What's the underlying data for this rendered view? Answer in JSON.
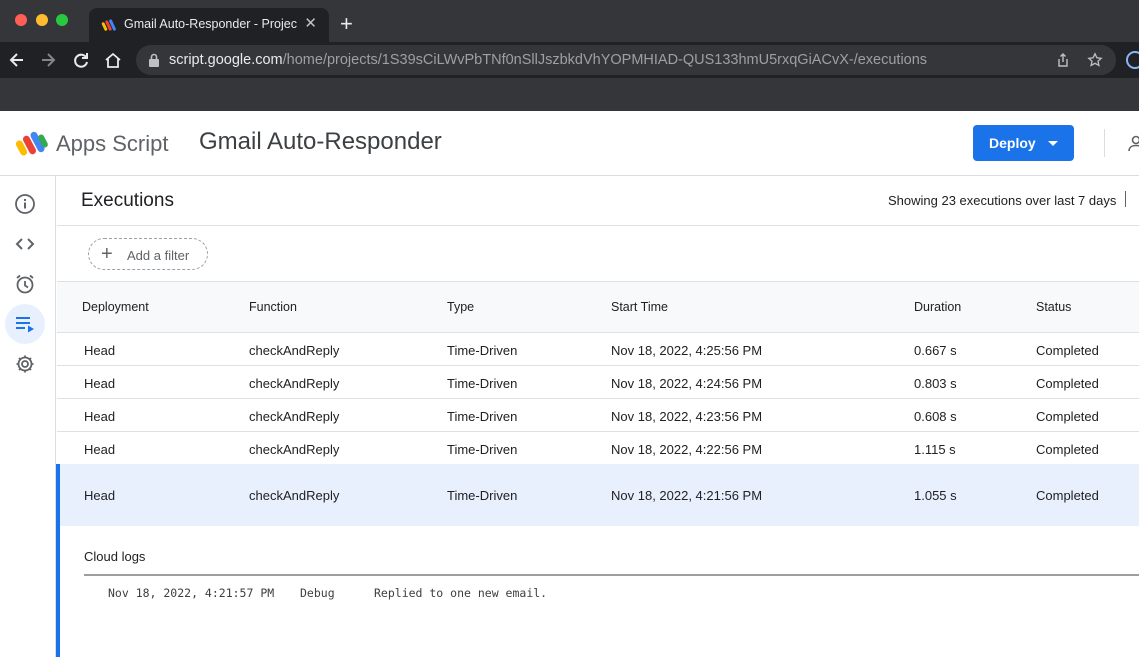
{
  "browser": {
    "tab_title": "Gmail Auto-Responder - Projec",
    "tab_close": "✕",
    "new_tab": "+",
    "url_host": "script.google.com",
    "url_path": "/home/projects/1S39sCiLWvPbTNf0nSllJszbkdVhYOPMHIAD-QUS133hmU5rxqGiACvX-/executions",
    "icons": [
      "back-icon",
      "forward-icon",
      "reload-icon",
      "home-icon",
      "lock-icon",
      "share-icon",
      "star-icon",
      "profile-icon"
    ]
  },
  "header": {
    "product_name": "Apps Script",
    "project_name": "Gmail Auto-Responder",
    "deploy_label": "Deploy"
  },
  "rail": {
    "items": [
      "overview-icon",
      "editor-icon",
      "triggers-icon",
      "executions-icon",
      "settings-icon"
    ],
    "active": "executions-icon"
  },
  "main": {
    "title": "Executions",
    "showing_text": "Showing 23 executions over last 7 days",
    "filter_label": "Add a filter",
    "filter_icon": "+",
    "columns": [
      "Deployment",
      "Function",
      "Type",
      "Start Time",
      "Duration",
      "Status"
    ],
    "rows": [
      [
        "Head",
        "checkAndReply",
        "Time-Driven",
        "Nov 18, 2022, 4:25:56 PM",
        "0.667 s",
        "Completed"
      ],
      [
        "Head",
        "checkAndReply",
        "Time-Driven",
        "Nov 18, 2022, 4:24:56 PM",
        "0.803 s",
        "Completed"
      ],
      [
        "Head",
        "checkAndReply",
        "Time-Driven",
        "Nov 18, 2022, 4:23:56 PM",
        "0.608 s",
        "Completed"
      ],
      [
        "Head",
        "checkAndReply",
        "Time-Driven",
        "Nov 18, 2022, 4:22:56 PM",
        "1.115 s",
        "Completed"
      ],
      [
        "Head",
        "checkAndReply",
        "Time-Driven",
        "Nov 18, 2022, 4:21:56 PM",
        "1.055 s",
        "Completed"
      ]
    ],
    "expanded_row_index": 4,
    "log": {
      "title": "Cloud logs",
      "entries": [
        {
          "time": "Nov 18, 2022, 4:21:57 PM",
          "level": "Debug",
          "message": "Replied to one new email."
        }
      ]
    }
  },
  "colors": {
    "accent": "#1a73e8",
    "selected_row": "#e8f0fe",
    "chrome_dark": "#202124"
  }
}
